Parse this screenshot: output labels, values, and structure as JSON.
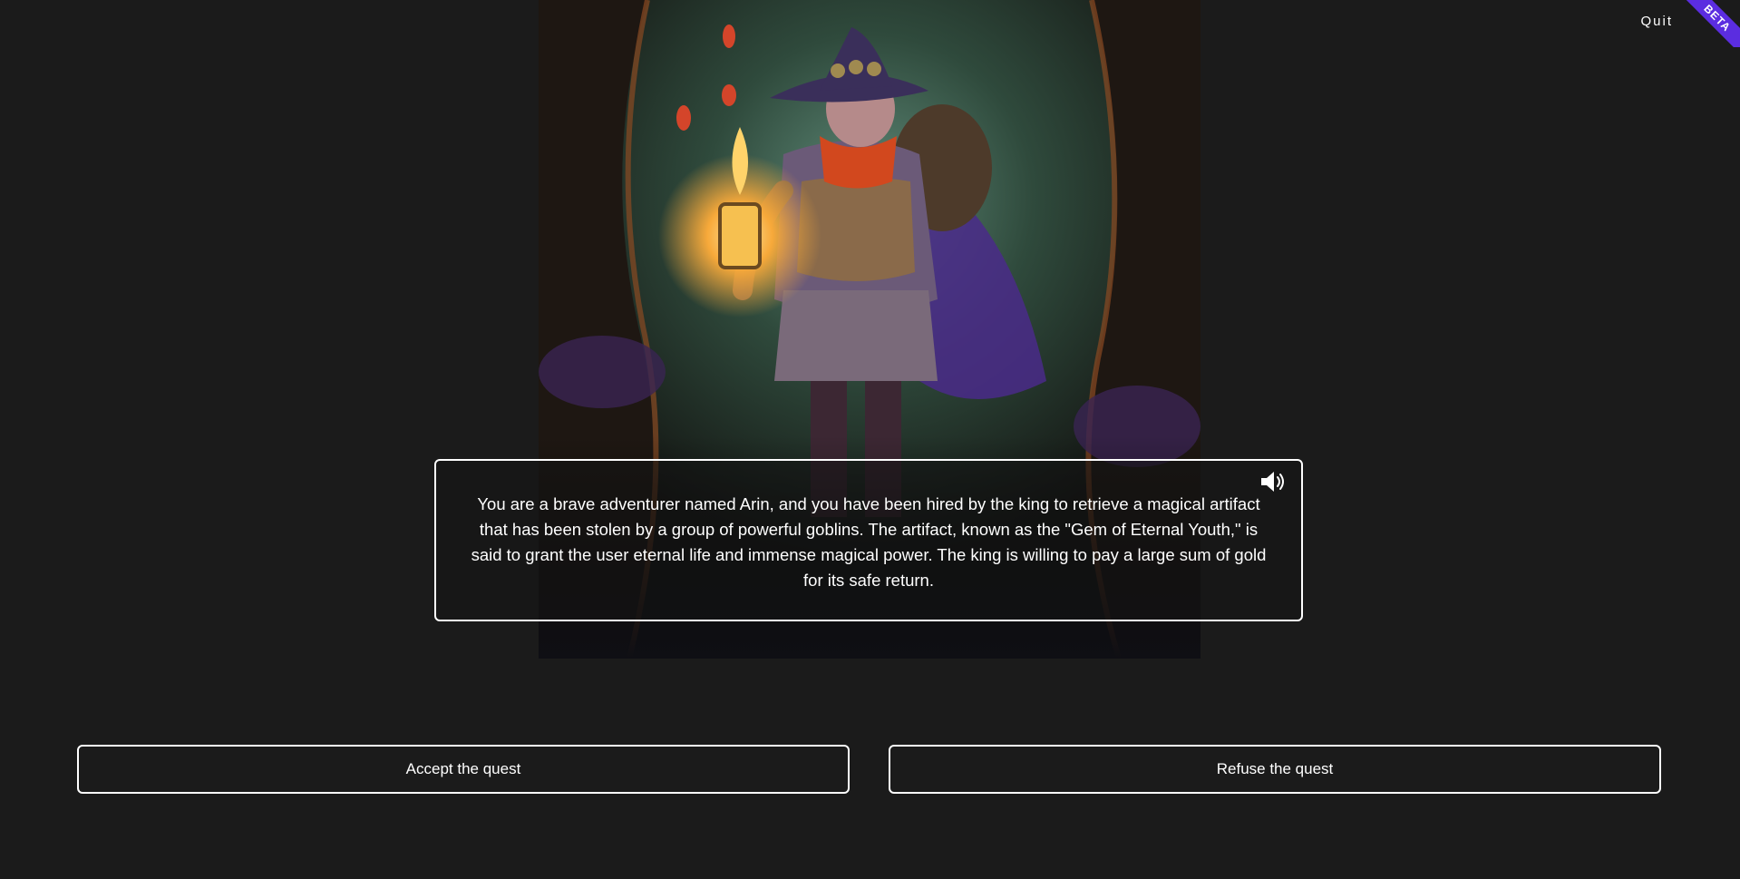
{
  "header": {
    "quit_label": "Quit",
    "beta_label": "BETA"
  },
  "scene": {
    "image_icon": "adventurer-with-lantern-in-forest"
  },
  "narration": {
    "text": "You are a brave adventurer named Arin, and you have been hired by the king to retrieve a magical artifact that has been stolen by a group of powerful goblins. The artifact, known as the \"Gem of Eternal Youth,\" is said to grant the user eternal life and immense magical power. The king is willing to pay a large sum of gold for its safe return.",
    "speaker_icon": "speaker-icon"
  },
  "choices": [
    {
      "label": "Accept the quest"
    },
    {
      "label": "Refuse the quest"
    }
  ],
  "colors": {
    "background": "#1b1b1b",
    "accent": "#5b2de0",
    "border": "#ffffff"
  }
}
